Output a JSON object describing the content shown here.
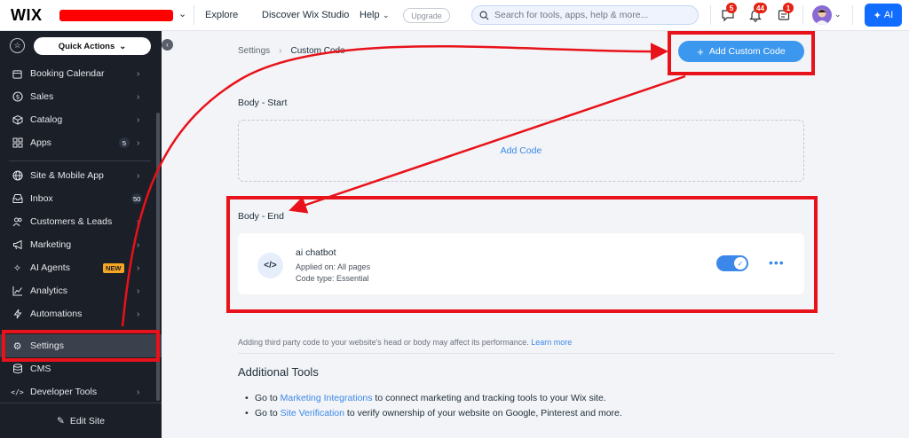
{
  "topbar": {
    "logo": "WIX",
    "nav": [
      "Explore",
      "Discover Wix Studio",
      "Help"
    ],
    "upgrade": "Upgrade",
    "search_placeholder": "Search for tools, apps, help & more...",
    "badges": {
      "messages": "5",
      "notifications": "44",
      "updates": "1"
    },
    "ai_label": "AI"
  },
  "sidebar": {
    "quick_actions": "Quick Actions",
    "items": [
      {
        "label": "Booking Calendar"
      },
      {
        "label": "Sales"
      },
      {
        "label": "Catalog"
      },
      {
        "label": "Apps",
        "count": "5"
      },
      {
        "label": "Site & Mobile App"
      },
      {
        "label": "Inbox",
        "count": "50"
      },
      {
        "label": "Customers & Leads"
      },
      {
        "label": "Marketing"
      },
      {
        "label": "AI Agents",
        "tag": "NEW"
      },
      {
        "label": "Analytics"
      },
      {
        "label": "Automations"
      },
      {
        "label": "Settings"
      },
      {
        "label": "CMS"
      },
      {
        "label": "Developer Tools"
      }
    ],
    "edit_site": "Edit Site"
  },
  "main": {
    "breadcrumb": {
      "parent": "Settings",
      "current": "Custom Code"
    },
    "add_custom_code": "Add Custom Code",
    "body_start": {
      "title": "Body - Start",
      "add_code": "Add Code"
    },
    "body_end": {
      "title": "Body - End",
      "snippet": {
        "name": "ai chatbot",
        "applied_on": "Applied on: All pages",
        "code_type": "Code type: Essential",
        "enabled": true
      }
    },
    "warning": {
      "text": "Adding third party code to your website's head or body may affect its performance.",
      "link": "Learn more"
    },
    "additional_tools": {
      "title": "Additional Tools",
      "items": [
        {
          "prefix": "Go to",
          "link": "Marketing Integrations",
          "suffix": "to connect marketing and tracking tools to your Wix site."
        },
        {
          "prefix": "Go to",
          "link": "Site Verification",
          "suffix": "to verify ownership of your website on Google, Pinterest and more."
        }
      ]
    }
  },
  "colors": {
    "accent": "#3b88ea",
    "annotation": "#e8121a",
    "sidebar_bg": "#1b1f27",
    "ai_button": "#116dff"
  }
}
